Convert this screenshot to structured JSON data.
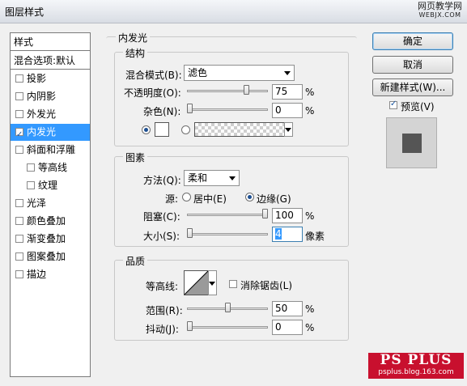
{
  "window": {
    "title": "图层样式"
  },
  "watermark": {
    "line1": "网页教学网",
    "line2": "WEBJX.COM"
  },
  "left_panel": {
    "header_styles": "样式",
    "header_blend": "混合选项:默认",
    "items": [
      {
        "label": "投影",
        "checked": false,
        "indent": false
      },
      {
        "label": "内阴影",
        "checked": false,
        "indent": false
      },
      {
        "label": "外发光",
        "checked": false,
        "indent": false
      },
      {
        "label": "内发光",
        "checked": true,
        "indent": false
      },
      {
        "label": "斜面和浮雕",
        "checked": false,
        "indent": false
      },
      {
        "label": "等高线",
        "checked": false,
        "indent": true
      },
      {
        "label": "纹理",
        "checked": false,
        "indent": true
      },
      {
        "label": "光泽",
        "checked": false,
        "indent": false
      },
      {
        "label": "颜色叠加",
        "checked": false,
        "indent": false
      },
      {
        "label": "渐变叠加",
        "checked": false,
        "indent": false
      },
      {
        "label": "图案叠加",
        "checked": false,
        "indent": false
      },
      {
        "label": "描边",
        "checked": false,
        "indent": false
      }
    ],
    "selected_index": 3
  },
  "main": {
    "section_title": "内发光",
    "structure": {
      "title": "结构",
      "blend_mode_label": "混合模式(B):",
      "blend_mode_value": "滤色",
      "opacity_label": "不透明度(O):",
      "opacity_value": "75",
      "opacity_fraction": 0.75,
      "noise_label": "杂色(N):",
      "noise_value": "0",
      "noise_fraction": 0,
      "percent": "%"
    },
    "elements": {
      "title": "图素",
      "technique_label": "方法(Q):",
      "technique_value": "柔和",
      "source_label": "源:",
      "source_center": "居中(E)",
      "source_edge": "边缘(G)",
      "choke_label": "阻塞(C):",
      "choke_value": "100",
      "choke_fraction": 1.0,
      "size_label": "大小(S):",
      "size_value": "4",
      "size_unit": "像素",
      "percent": "%"
    },
    "quality": {
      "title": "品质",
      "contour_label": "等高线:",
      "anti_alias_label": "消除锯齿(L)",
      "range_label": "范围(R):",
      "range_value": "50",
      "range_fraction": 0.5,
      "jitter_label": "抖动(J):",
      "jitter_value": "0",
      "jitter_fraction": 0,
      "percent": "%"
    }
  },
  "buttons": {
    "ok": "确定",
    "cancel": "取消",
    "new_style": "新建样式(W)...",
    "preview_label": "预览(V)"
  },
  "logo": {
    "line1": "PS PLUS",
    "line2": "psplus.blog.163.com"
  },
  "colors": {
    "selection": "#3399ff",
    "glow_color": "#ffffff",
    "preview_square": "#555555",
    "logo_bg": "#c8102e"
  }
}
